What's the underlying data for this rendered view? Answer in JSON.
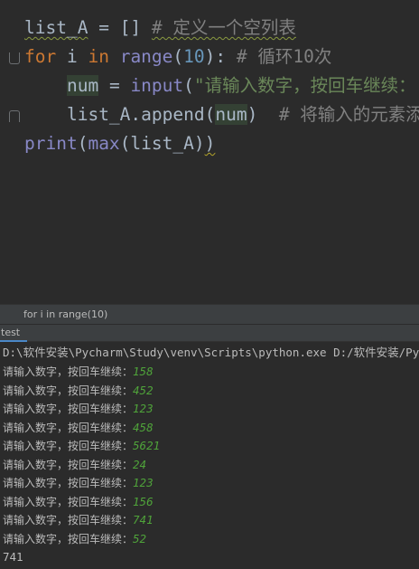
{
  "editor": {
    "lines": [
      {
        "v1": "list_A",
        "op": " = ",
        "br": "[]",
        "sp": "  ",
        "cmt": "# 定义一个空列表"
      },
      {
        "kw": "for",
        "t1": " i ",
        "kw2": "in",
        "sp": " ",
        "fn": "range",
        "p1": "(",
        "num": "10",
        "p2": "):",
        "sp2": "  ",
        "cmt": "# 循环10次"
      },
      {
        "ind": "    ",
        "v1": "num",
        "op": " = ",
        "fn": "input",
        "p1": "(",
        "str": "\"请输入数字，按回车继续："
      },
      {
        "ind": "    ",
        "t1": "list_A.append(",
        "v1": "num",
        "t2": ")",
        "sp": "  ",
        "cmt": "# 将输入的元素添"
      },
      {
        "fn": "print",
        "p1": "(",
        "fn2": "max",
        "p2": "(list_A)",
        "p3": ")"
      }
    ]
  },
  "breadcrumb": {
    "text": "for i in range(10)"
  },
  "run": {
    "tab_label": "test",
    "command": "D:\\软件安装\\Pycharm\\Study\\venv\\Scripts\\python.exe D:/软件安装/Pycharm",
    "prompt": "请输入数字，按回车继续：",
    "inputs": [
      "158",
      "452",
      "123",
      "458",
      "5621",
      "24",
      "123",
      "156",
      "741",
      "52"
    ],
    "result": "741"
  }
}
